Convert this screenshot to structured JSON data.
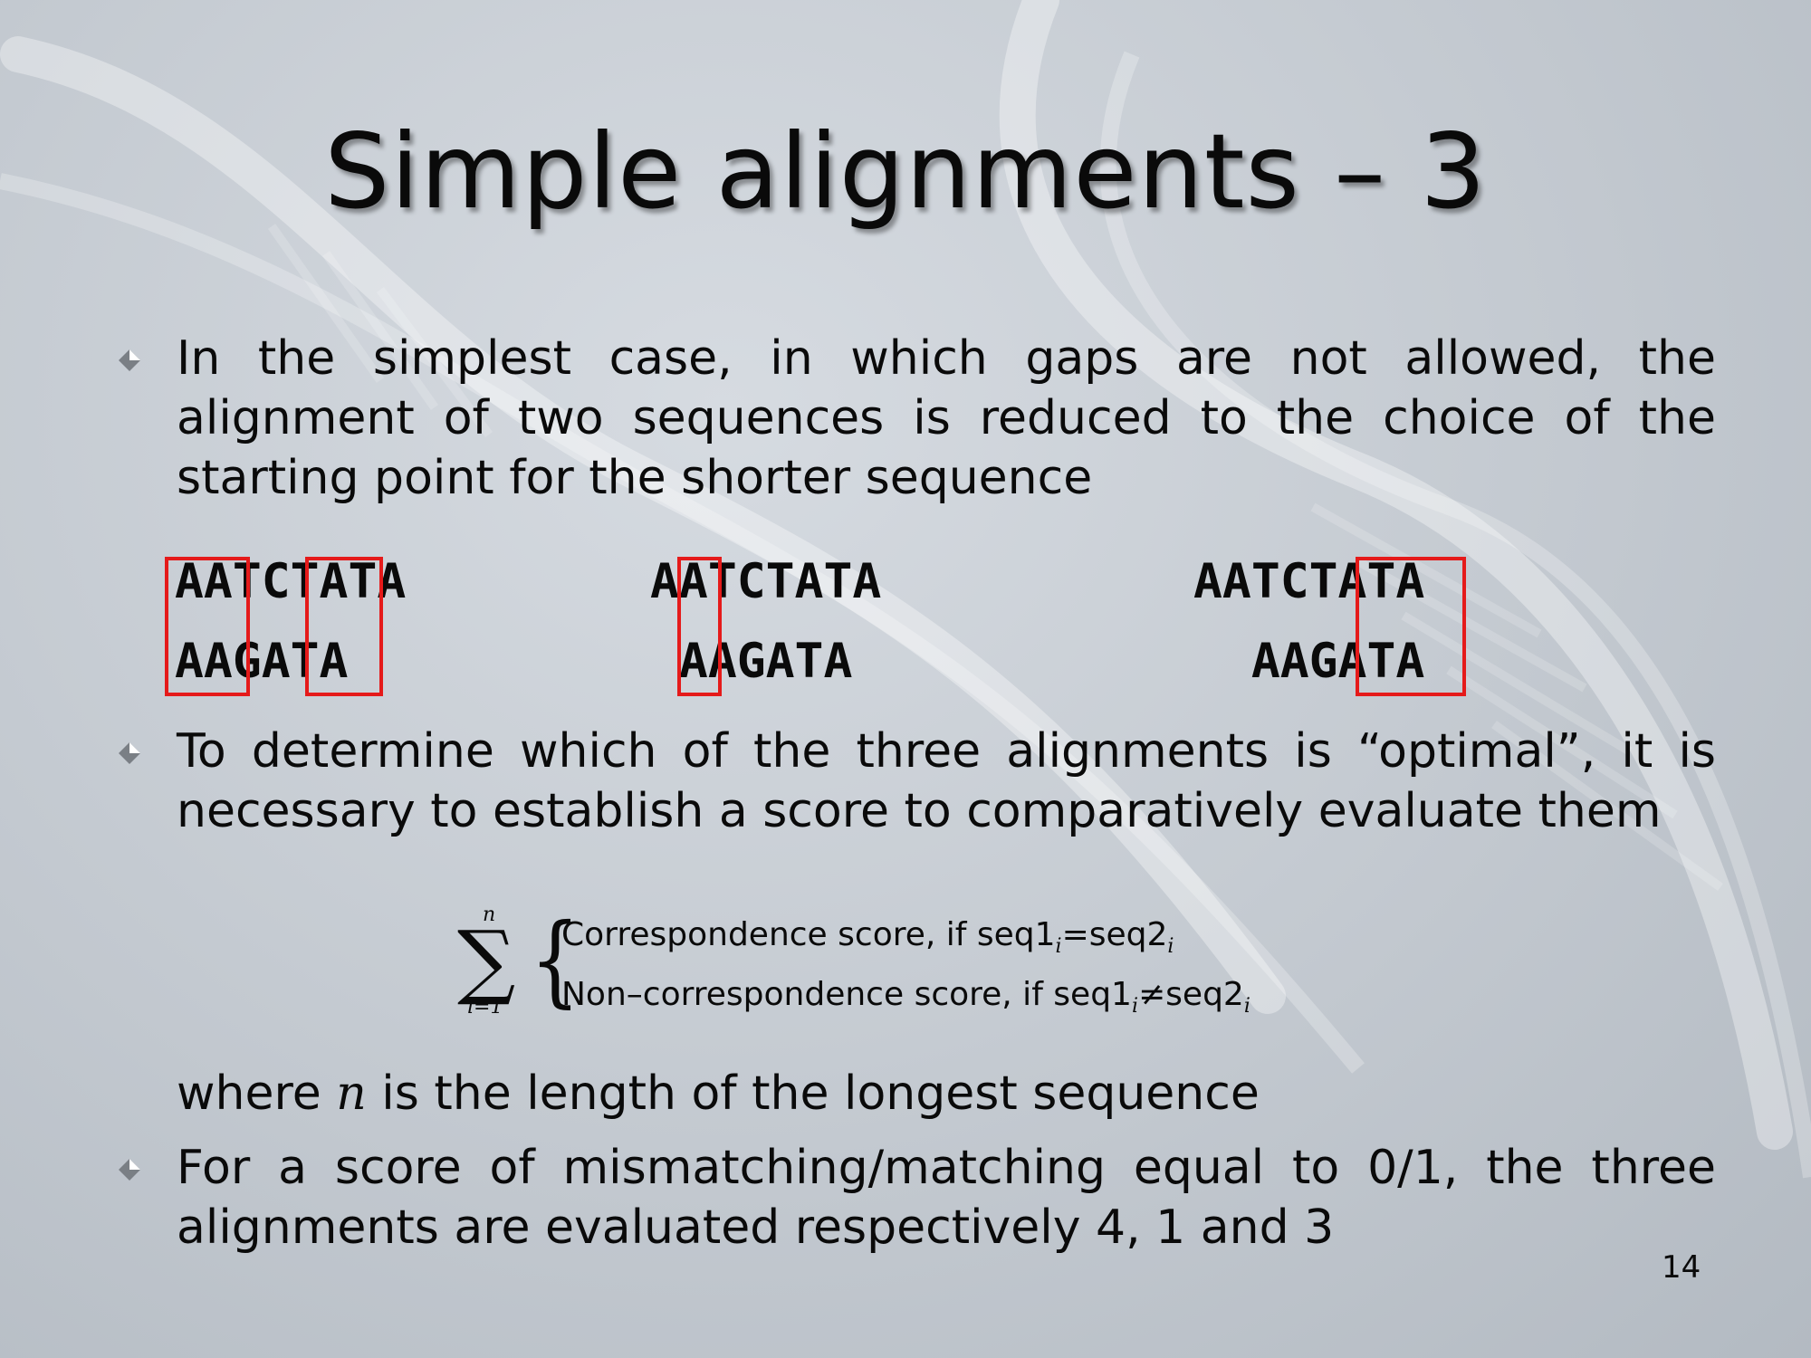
{
  "slide": {
    "title": "Simple alignments – 3",
    "bullet1": "In the simplest case, in which gaps are not allowed, the alignment of two sequences is reduced to the choice of the starting point for the shorter sequence",
    "bullet2": "To determine which of the three alignments is “optimal”, it is necessary to establish a score to comparatively evaluate them",
    "where_pre": "where ",
    "where_var": "n",
    "where_post": " is the length of the longest sequence",
    "bullet3": "For a score of mismatching/matching equal to 0/1, the three alignments are evaluated respectively 4, 1 and 3",
    "page_number": "14"
  },
  "alignments": [
    {
      "seq1": "AATCTATA",
      "seq2": "AAGATA"
    },
    {
      "seq1": "AATCTATA",
      "seq2": " AAGATA"
    },
    {
      "seq1": "AATCTATA",
      "seq2": "  AAGATA"
    }
  ],
  "formula": {
    "sum_upper": "n",
    "sum_lower": "i=1",
    "case1_text": "Correspondence score, if seq1",
    "case1_sub1": "i",
    "case1_eq": "=seq2",
    "case1_sub2": "i",
    "case2_text": "Non–correspondence score, if seq1",
    "case2_sub1": "i",
    "case2_neq": "≠seq2",
    "case2_sub2": "i"
  },
  "colors": {
    "highlight": "#e51a1a"
  }
}
